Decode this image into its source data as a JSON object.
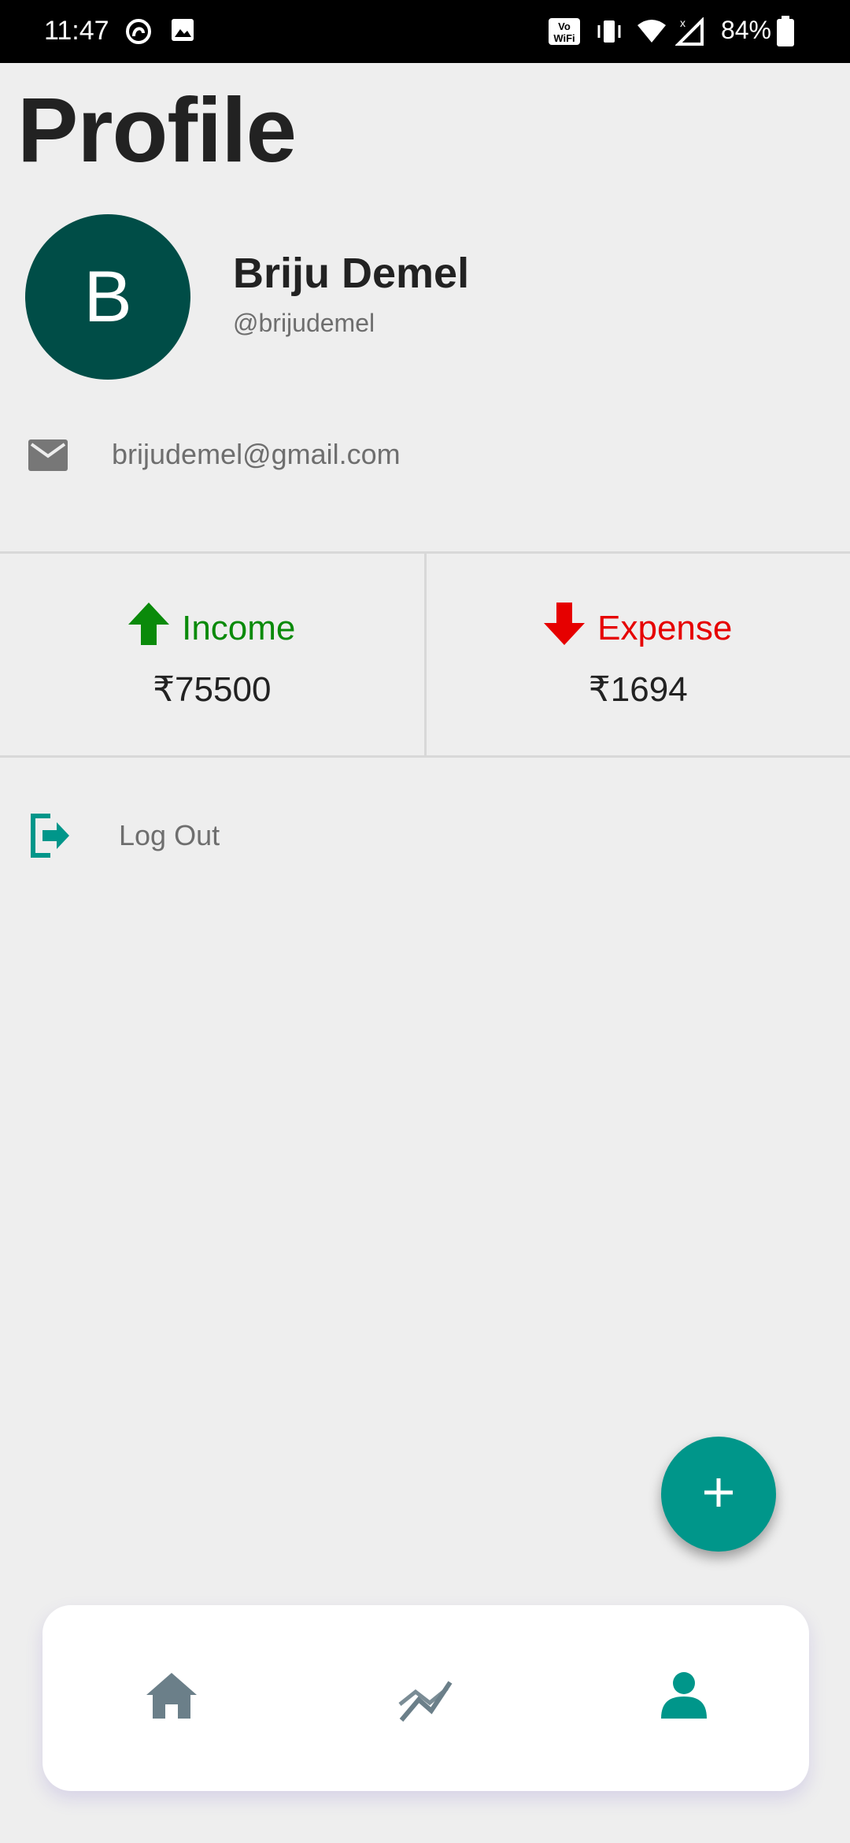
{
  "status_bar": {
    "time": "11:47",
    "battery": "84%",
    "icons": [
      "sync-icon",
      "image-icon",
      "vowifi-icon",
      "vibrate-icon",
      "wifi-icon",
      "signal-icon",
      "battery-icon"
    ]
  },
  "page": {
    "title": "Profile"
  },
  "profile": {
    "avatar_initial": "B",
    "name": "Briju Demel",
    "handle": "@brijudemel",
    "email": "brijudemel@gmail.com"
  },
  "stats": {
    "income": {
      "label": "Income",
      "value": "₹75500",
      "color": "#0a8a0a",
      "icon": "arrow-up-icon"
    },
    "expense": {
      "label": "Expense",
      "value": "₹1694",
      "color": "#e60000",
      "icon": "arrow-down-icon"
    }
  },
  "actions": {
    "logout_label": "Log Out"
  },
  "nav": {
    "items": [
      {
        "name": "home",
        "icon": "home-icon",
        "active": false
      },
      {
        "name": "stats",
        "icon": "trend-icon",
        "active": false
      },
      {
        "name": "profile",
        "icon": "person-icon",
        "active": true
      }
    ]
  },
  "colors": {
    "accent": "#00968a",
    "avatar_bg": "#004d47",
    "nav_inactive": "#6b7f89",
    "background": "#eeeeee"
  }
}
